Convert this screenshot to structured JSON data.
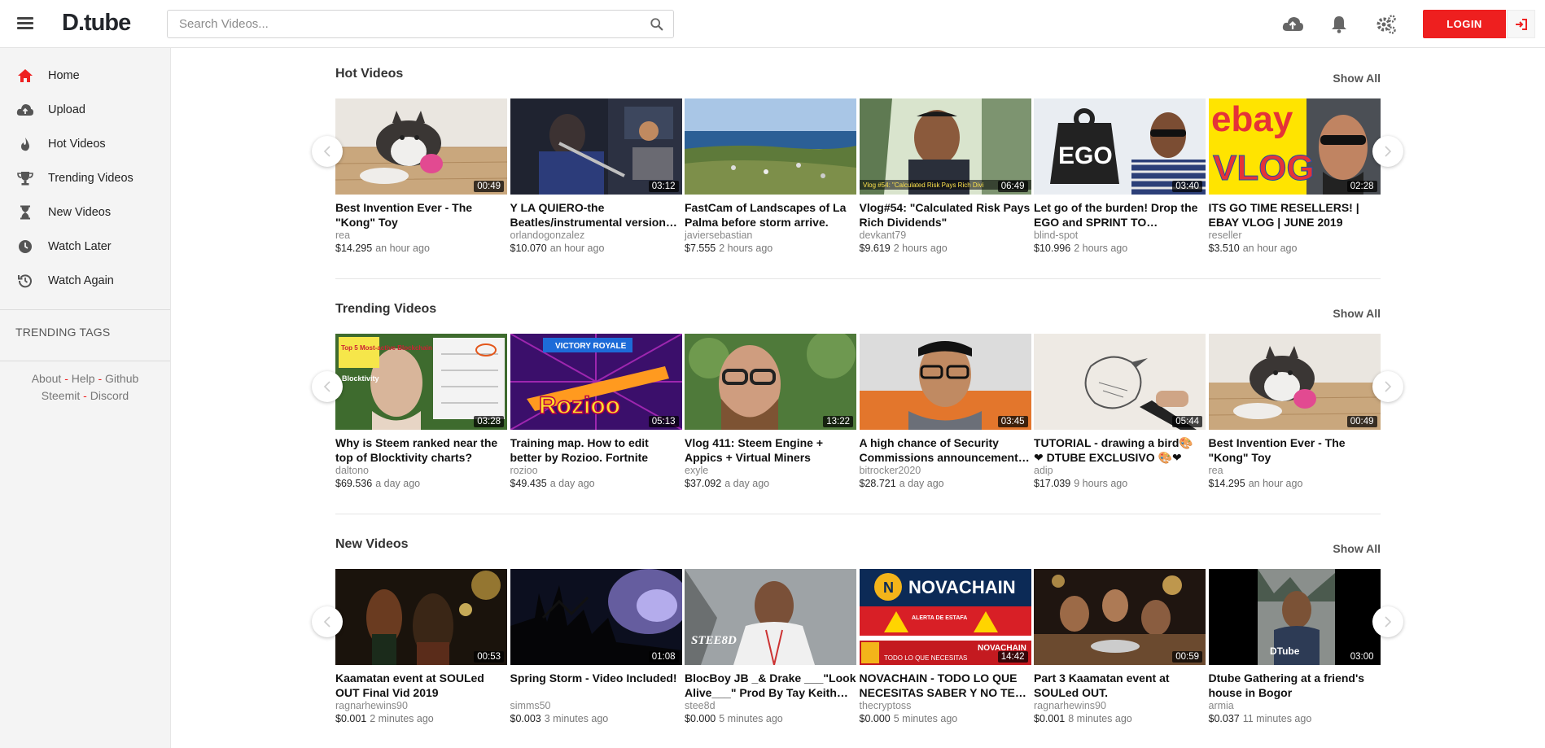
{
  "header": {
    "logo_main": "D",
    "logo_dot": ".",
    "logo_rest": "tube",
    "search_placeholder": "Search Videos...",
    "login_label": "LOGIN"
  },
  "sidebar": {
    "items": [
      {
        "label": "Home",
        "icon": "home-icon"
      },
      {
        "label": "Upload",
        "icon": "cloud-upload-icon"
      },
      {
        "label": "Hot Videos",
        "icon": "fire-icon"
      },
      {
        "label": "Trending Videos",
        "icon": "trophy-icon"
      },
      {
        "label": "New Videos",
        "icon": "hourglass-icon"
      },
      {
        "label": "Watch Later",
        "icon": "clock-icon"
      },
      {
        "label": "Watch Again",
        "icon": "history-icon"
      }
    ],
    "trending_tags": "TRENDING TAGS",
    "footer": {
      "about": "About",
      "help": "Help",
      "github": "Github",
      "steemit": "Steemit",
      "discord": "Discord",
      "sep": "-"
    }
  },
  "sections": [
    {
      "title": "Hot Videos",
      "show_all": "Show All",
      "videos": [
        {
          "title": "Best Invention Ever - The \"Kong\" Toy",
          "author": "rea",
          "payout": "$14.295",
          "ago": "an hour ago",
          "duration": "00:49"
        },
        {
          "title": "Y LA QUIERO-the Beatles/instrumental version by…",
          "author": "orlandogonzalez",
          "payout": "$10.070",
          "ago": "an hour ago",
          "duration": "03:12"
        },
        {
          "title": "FastCam of Landscapes of La Palma before storm arrive.",
          "author": "javiersebastian",
          "payout": "$7.555",
          "ago": "2 hours ago",
          "duration": ""
        },
        {
          "title": "Vlog#54: \"Calculated Risk Pays Rich Dividends\"",
          "author": "devkant79",
          "payout": "$9.619",
          "ago": "2 hours ago",
          "duration": "06:49"
        },
        {
          "title": "Let go of the burden! Drop the EGO and SPRINT TO SUCCESS.",
          "author": "blind-spot",
          "payout": "$10.996",
          "ago": "2 hours ago",
          "duration": "03:40"
        },
        {
          "title": "ITS GO TIME RESELLERS! | EBAY VLOG | JUNE 2019",
          "author": "reseller",
          "payout": "$3.510",
          "ago": "an hour ago",
          "duration": "02:28"
        }
      ]
    },
    {
      "title": "Trending Videos",
      "show_all": "Show All",
      "videos": [
        {
          "title": "Why is Steem ranked near the top of Blocktivity charts?",
          "author": "daltono",
          "payout": "$69.536",
          "ago": "a day ago",
          "duration": "03:28"
        },
        {
          "title": "Training map. How to edit better by Rozioo. Fortnite",
          "author": "rozioo",
          "payout": "$49.435",
          "ago": "a day ago",
          "duration": "05:13"
        },
        {
          "title": "Vlog 411: Steem Engine + Appics + Virtual Miners",
          "author": "exyle",
          "payout": "$37.092",
          "ago": "a day ago",
          "duration": "13:22"
        },
        {
          "title": "A high chance of Security Commissions announcement of…",
          "author": "bitrocker2020",
          "payout": "$28.721",
          "ago": "a day ago",
          "duration": "03:45"
        },
        {
          "title": "TUTORIAL - drawing a bird🎨 ❤ DTUBE EXCLUSIVO 🎨❤",
          "author": "adip",
          "payout": "$17.039",
          "ago": "9 hours ago",
          "duration": "05:44"
        },
        {
          "title": "Best Invention Ever - The \"Kong\" Toy",
          "author": "rea",
          "payout": "$14.295",
          "ago": "an hour ago",
          "duration": "00:49"
        }
      ]
    },
    {
      "title": "New Videos",
      "show_all": "Show All",
      "videos": [
        {
          "title": "Kaamatan event at SOULed OUT Final Vid 2019",
          "author": "ragnarhewins90",
          "payout": "$0.001",
          "ago": "2 minutes ago",
          "duration": "00:53"
        },
        {
          "title": "Spring Storm - Video Included!",
          "author": "simms50",
          "payout": "$0.003",
          "ago": "3 minutes ago",
          "duration": "01:08"
        },
        {
          "title": "BlocBoy JB _& Drake ___\"Look Alive___\" Prod By Tay Keith…",
          "author": "stee8d",
          "payout": "$0.000",
          "ago": "5 minutes ago",
          "duration": ""
        },
        {
          "title": "NOVACHAIN - TODO LO QUE NECESITAS SABER Y NO TE…",
          "author": "thecryptoss",
          "payout": "$0.000",
          "ago": "5 minutes ago",
          "duration": "14:42"
        },
        {
          "title": "Part 3 Kaamatan event at SOULed OUT.",
          "author": "ragnarhewins90",
          "payout": "$0.001",
          "ago": "8 minutes ago",
          "duration": "00:59"
        },
        {
          "title": "Dtube Gathering at a friend's house in Bogor",
          "author": "armia",
          "payout": "$0.037",
          "ago": "11 minutes ago",
          "duration": "03:00"
        }
      ]
    }
  ],
  "thumb_texts": {
    "ego": "EGO",
    "ebay": "ebay",
    "vlog": "VLOG",
    "rozioo": "Rozioo",
    "novachain": "NOVACHAIN",
    "steemd": "STEE8D",
    "dtube": "DTube",
    "vlog54_banner": "Vlog #54: \"Calculated Risk Pays Rich Divi",
    "top5": "Top 5 Most-active Blockchain",
    "blocktivity": "Blocktivity",
    "victory": "VICTORY ROYALE",
    "alerta": "ALERTA DE ESTAFA",
    "todo": "TODO LO QUE NECESITAS",
    "novachain2": "NOVACHAIN"
  },
  "colors": {
    "accent": "#ee1f1f",
    "sidebar_bg": "#f4f4f4",
    "text": "#222222"
  }
}
